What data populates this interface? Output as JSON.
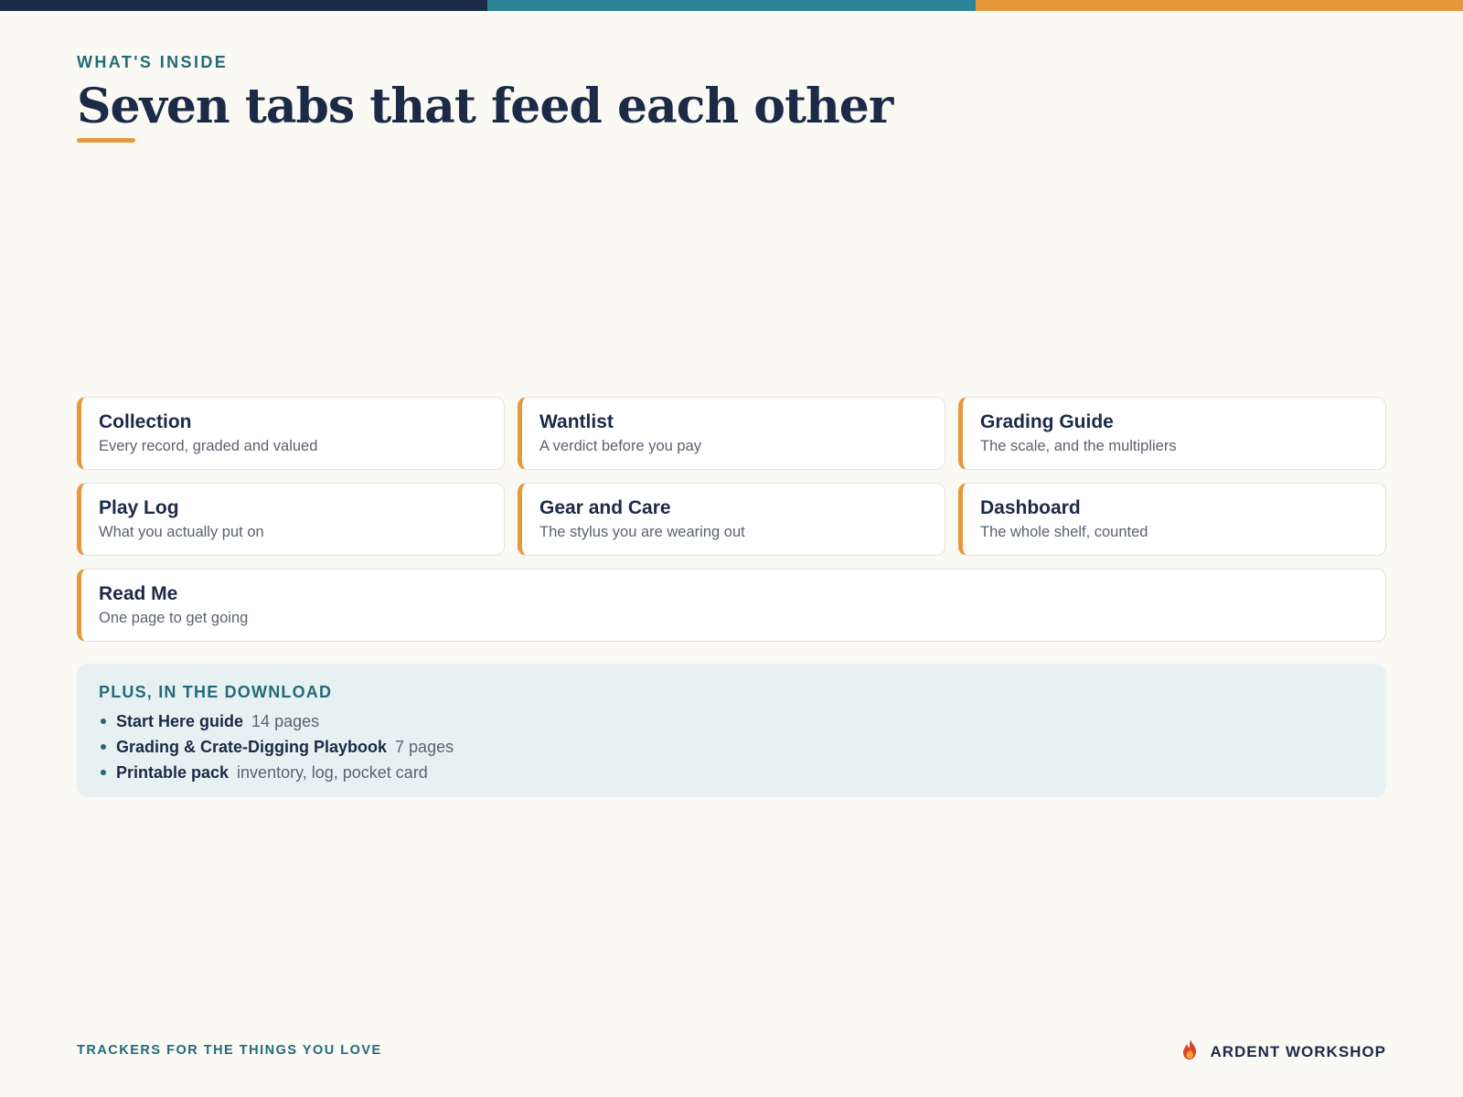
{
  "colors": {
    "navy": "#1b2a47",
    "teal": "#2b8496",
    "orange": "#e8983c",
    "accent_teal_text": "#226a7a",
    "background": "#faf9f4",
    "extras_bg": "#e8f1f2"
  },
  "header": {
    "eyebrow": "WHAT'S INSIDE",
    "title": "Seven tabs that feed each other"
  },
  "tabs": [
    {
      "title": "Collection",
      "subtitle": "Every record, graded and valued"
    },
    {
      "title": "Wantlist",
      "subtitle": "A verdict before you pay"
    },
    {
      "title": "Grading Guide",
      "subtitle": "The scale, and the multipliers"
    },
    {
      "title": "Play Log",
      "subtitle": "What you actually put on"
    },
    {
      "title": "Gear and Care",
      "subtitle": "The stylus you are wearing out"
    },
    {
      "title": "Dashboard",
      "subtitle": "The whole shelf, counted"
    },
    {
      "title": "Read Me",
      "subtitle": "One page to get going"
    }
  ],
  "extras": {
    "heading": "PLUS, IN THE DOWNLOAD",
    "items": [
      {
        "name": "Start Here guide",
        "detail": "14 pages"
      },
      {
        "name": "Grading & Crate-Digging Playbook",
        "detail": "7 pages"
      },
      {
        "name": "Printable pack",
        "detail": "inventory, log, pocket card"
      }
    ]
  },
  "footer": {
    "tagline": "TRACKERS FOR THE THINGS YOU LOVE",
    "brand_name": "ARDENT WORKSHOP",
    "brand_icon": "flame-icon"
  }
}
